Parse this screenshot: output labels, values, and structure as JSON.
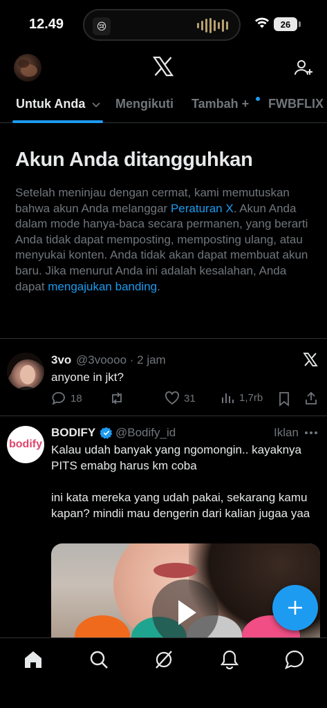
{
  "status_bar": {
    "time": "12.49",
    "battery": "26",
    "live_activity_emoji": "😢"
  },
  "header": {
    "logo": "X",
    "icons": [
      "avatar",
      "x-logo-icon",
      "add-user-icon"
    ]
  },
  "tabs": [
    {
      "label": "Untuk Anda",
      "active": true,
      "has_dropdown": true
    },
    {
      "label": "Mengikuti",
      "active": false
    },
    {
      "label": "Tambah +",
      "active": false,
      "has_dot": true
    },
    {
      "label": "FWBFLIX S",
      "active": false
    }
  ],
  "notice": {
    "title": "Akun Anda ditangguhkan",
    "body_1": "Setelah meninjau dengan cermat, kami memutuskan bahwa akun Anda melanggar ",
    "link_1": "Peraturan X",
    "body_2": ". Akun Anda dalam mode hanya-baca secara permanen, yang berarti Anda tidak dapat memposting, memposting ulang, atau menyukai konten. Anda tidak akan dapat membuat akun baru. Jika menurut Anda ini adalah kesalahan, Anda dapat ",
    "link_2": "mengajukan banding",
    "body_3": "."
  },
  "posts": [
    {
      "name": "3vo",
      "handle": "@3voooo",
      "time": "· 2 jam",
      "text": "anyone in jkt?",
      "replies": "18",
      "retweets": "",
      "likes": "31",
      "views": "1,7rb"
    },
    {
      "name": "BODIFY",
      "handle": "@Bodify_id",
      "badge": "Iklan",
      "avatar_text": "bodify",
      "text_1": "Kalau udah banyak yang ngomongin.. kayaknya PITS emabg harus km coba",
      "text_2": "ini kata mereka yang udah pakai, sekarang kamu kapan? mindii mau dengerin dari kalian jugaa yaa"
    }
  ],
  "bottom_nav": [
    "home-icon",
    "search-icon",
    "grok-icon",
    "notifications-icon",
    "messages-icon"
  ],
  "colors": {
    "accent": "#1d9bf0",
    "text": "#e7e9ea",
    "muted": "#71767b",
    "divider": "#2f3336"
  }
}
